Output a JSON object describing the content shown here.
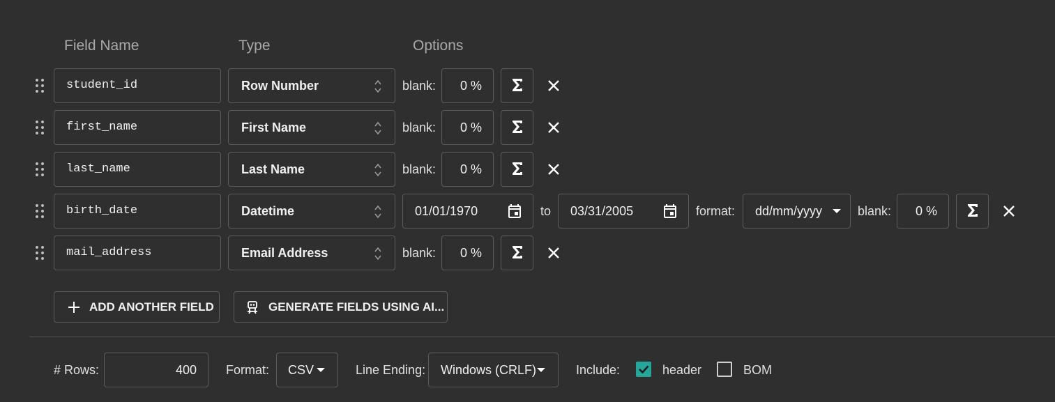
{
  "headers": {
    "field_name": "Field Name",
    "type": "Type",
    "options": "Options"
  },
  "labels": {
    "blank": "blank:",
    "to": "to",
    "format": "format:"
  },
  "fields": [
    {
      "name": "student_id",
      "type": "Row Number",
      "blank": "0 %"
    },
    {
      "name": "first_name",
      "type": "First Name",
      "blank": "0 %"
    },
    {
      "name": "last_name",
      "type": "Last Name",
      "blank": "0 %"
    },
    {
      "name": "birth_date",
      "type": "Datetime",
      "from": "01/01/1970",
      "to": "03/31/2005",
      "format": "dd/mm/yyyy",
      "blank": "0 %"
    },
    {
      "name": "mail_address",
      "type": "Email Address",
      "blank": "0 %"
    }
  ],
  "buttons": {
    "add_field": "ADD ANOTHER FIELD",
    "generate_ai": "GENERATE FIELDS USING AI..."
  },
  "footer": {
    "rows_label": "# Rows:",
    "rows_value": "400",
    "format_label": "Format:",
    "format_value": "CSV",
    "line_ending_label": "Line Ending:",
    "line_ending_value": "Windows (CRLF)",
    "include_label": "Include:",
    "header_label": "header",
    "header_checked": true,
    "bom_label": "BOM",
    "bom_checked": false
  },
  "colors": {
    "background": "#2f2f2f",
    "border": "#5b5b5b",
    "accent": "#26a69a"
  }
}
